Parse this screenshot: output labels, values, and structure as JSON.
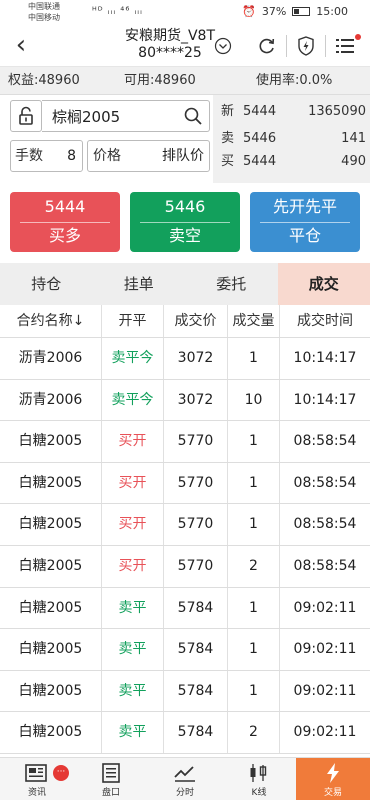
{
  "status_bar": {
    "carrier1": "中国联通",
    "carrier2": "中国移动",
    "signal": "ᴴᴰ ᵢᵢᵢ ⁴⁶ ᵢᵢᵢ",
    "battery": "37%",
    "time": "15:00"
  },
  "header": {
    "title_line1": "安粮期货_V8T",
    "title_line2": "80****25"
  },
  "account": {
    "equity": "权益:48960",
    "available": "可用:48960",
    "usage": "使用率:0.0%"
  },
  "order": {
    "contract": "棕榈2005",
    "qty_label": "手数",
    "qty_value": "8",
    "price_label": "价格",
    "price_value": "排队价"
  },
  "quote": {
    "rows": [
      {
        "label": "新",
        "price": "5444",
        "volume": "1365090"
      },
      {
        "label": "卖",
        "price": "5446",
        "volume": "141"
      },
      {
        "label": "买",
        "price": "5444",
        "volume": "490"
      }
    ]
  },
  "buttons": {
    "buy_price": "5444",
    "buy_label": "买多",
    "sell_price": "5446",
    "sell_label": "卖空",
    "close_label_top": "先开先平",
    "close_label": "平仓"
  },
  "tabs": [
    "持仓",
    "挂单",
    "委托",
    "成交"
  ],
  "table": {
    "headers": [
      "合约名称↓",
      "开平",
      "成交价",
      "成交量",
      "成交时间"
    ],
    "rows": [
      {
        "name": "沥青2006",
        "action": "卖平今",
        "price": "3072",
        "qty": "1",
        "time": "10:14:17",
        "color": "green"
      },
      {
        "name": "沥青2006",
        "action": "卖平今",
        "price": "3072",
        "qty": "10",
        "time": "10:14:17",
        "color": "green"
      },
      {
        "name": "白糖2005",
        "action": "买开",
        "price": "5770",
        "qty": "1",
        "time": "08:58:54",
        "color": "red"
      },
      {
        "name": "白糖2005",
        "action": "买开",
        "price": "5770",
        "qty": "1",
        "time": "08:58:54",
        "color": "red"
      },
      {
        "name": "白糖2005",
        "action": "买开",
        "price": "5770",
        "qty": "1",
        "time": "08:58:54",
        "color": "red"
      },
      {
        "name": "白糖2005",
        "action": "买开",
        "price": "5770",
        "qty": "2",
        "time": "08:58:54",
        "color": "red"
      },
      {
        "name": "白糖2005",
        "action": "卖平",
        "price": "5784",
        "qty": "1",
        "time": "09:02:11",
        "color": "green"
      },
      {
        "name": "白糖2005",
        "action": "卖平",
        "price": "5784",
        "qty": "1",
        "time": "09:02:11",
        "color": "green"
      },
      {
        "name": "白糖2005",
        "action": "卖平",
        "price": "5784",
        "qty": "1",
        "time": "09:02:11",
        "color": "green"
      },
      {
        "name": "白糖2005",
        "action": "卖平",
        "price": "5784",
        "qty": "2",
        "time": "09:02:11",
        "color": "green"
      }
    ]
  },
  "bottom_nav": {
    "items": [
      "资讯",
      "盘口",
      "分时",
      "K线",
      "交易"
    ],
    "badge": "···"
  },
  "colors": {
    "buy": "#e85258",
    "sell": "#12a05c",
    "close": "#3b8fd1",
    "active_tab": "#f8d9cf",
    "active_nav": "#f07b3a"
  }
}
